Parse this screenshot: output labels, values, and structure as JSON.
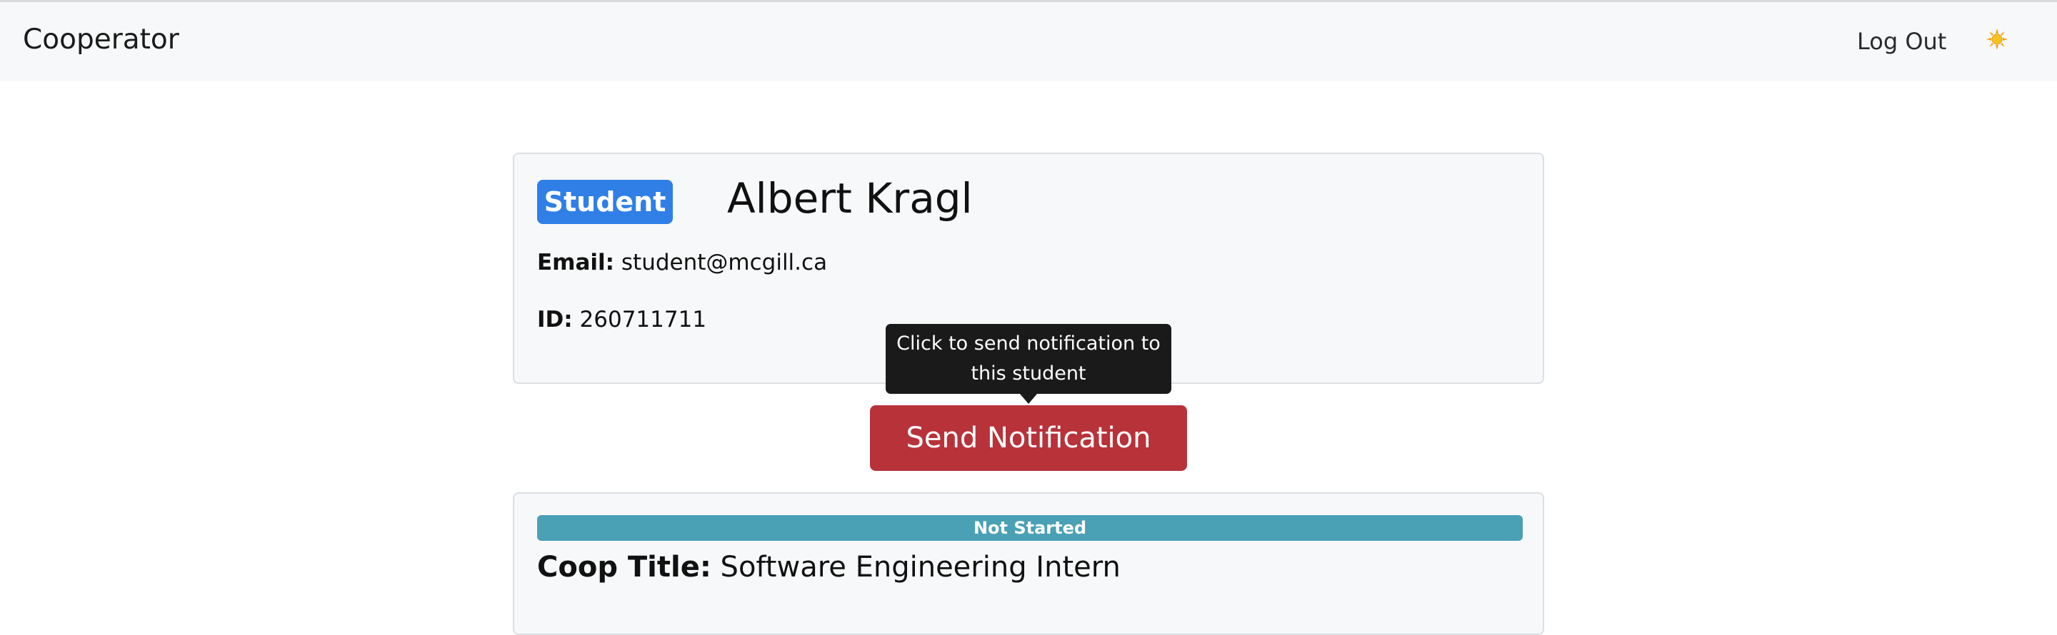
{
  "navbar": {
    "brand": "Cooperator",
    "logout_label": "Log Out",
    "theme_icon": "sun-icon"
  },
  "profile": {
    "role_badge": "Student",
    "name": "Albert Kragl",
    "email_label": "Email:",
    "email_value": "student@mcgill.ca",
    "id_label": "ID:",
    "id_value": "260711711"
  },
  "notification": {
    "tooltip": "Click to send notification to this student",
    "button_label": "Send Notification"
  },
  "coop": {
    "status": "Not Started",
    "title_label": "Coop Title:",
    "title_value": "Software Engineering Intern"
  },
  "colors": {
    "badge_blue": "#2f7fe6",
    "send_red": "#b8323a",
    "status_teal": "#4aa0b5",
    "navbar_bg": "#f7f8f9"
  }
}
